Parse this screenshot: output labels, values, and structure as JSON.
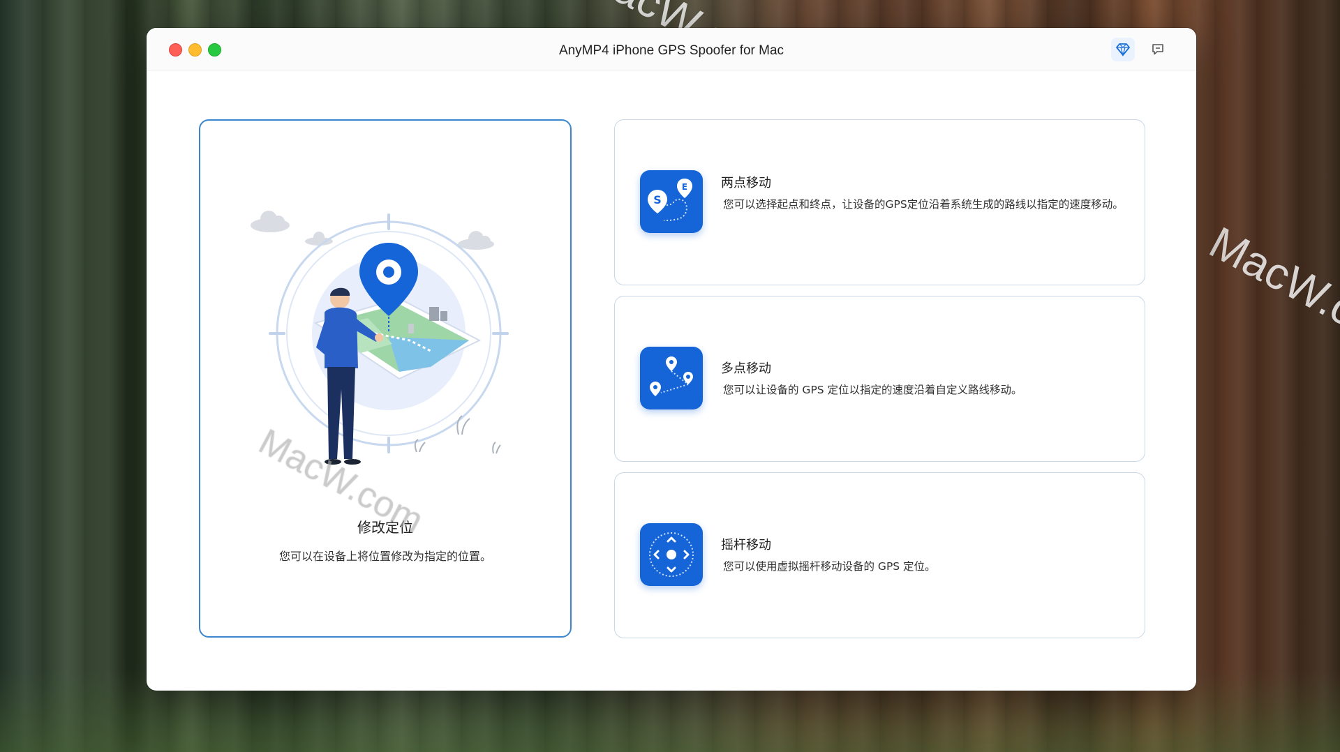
{
  "window": {
    "title": "AnyMP4 iPhone GPS Spoofer for Mac"
  },
  "titlebar": {
    "premium_icon": "diamond-icon",
    "feedback_icon": "message-icon"
  },
  "main_card": {
    "title": "修改定位",
    "description": "您可以在设备上将位置修改为指定的位置。"
  },
  "options": [
    {
      "title": "两点移动",
      "description": "您可以选择起点和终点，让设备的GPS定位沿着系统生成的路线以指定的速度移动。",
      "icon": "two-point-route-icon"
    },
    {
      "title": "多点移动",
      "description": "您可以让设备的 GPS 定位以指定的速度沿着自定义路线移动。",
      "icon": "multi-point-route-icon"
    },
    {
      "title": "摇杆移动",
      "description": "您可以使用虚拟摇杆移动设备的 GPS 定位。",
      "icon": "joystick-icon"
    }
  ],
  "watermark": "MacW.com",
  "colors": {
    "accent": "#1565d8",
    "selected_border": "#3b86cc"
  }
}
